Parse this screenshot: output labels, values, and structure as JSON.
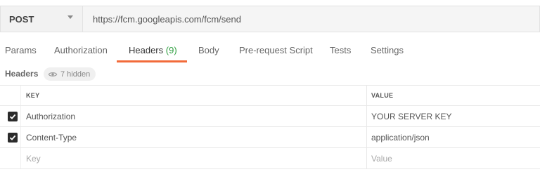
{
  "request": {
    "method": "POST",
    "url": "https://fcm.googleapis.com/fcm/send"
  },
  "tabs": [
    {
      "label": "Params"
    },
    {
      "label": "Authorization"
    },
    {
      "label": "Headers",
      "count": "(9)",
      "active": true
    },
    {
      "label": "Body"
    },
    {
      "label": "Pre-request Script"
    },
    {
      "label": "Tests"
    },
    {
      "label": "Settings"
    }
  ],
  "headers_section": {
    "title": "Headers",
    "hidden_label": "7 hidden"
  },
  "table": {
    "columns": [
      "KEY",
      "VALUE"
    ],
    "rows": [
      {
        "key": "Authorization",
        "value": "YOUR SERVER KEY",
        "checked": true
      },
      {
        "key": "Content-Type",
        "value": "application/json",
        "checked": true
      }
    ],
    "placeholder_row": {
      "key": "Key",
      "value": "Value"
    }
  },
  "colors": {
    "accent_underline": "#f26b3a",
    "count_green": "#2e9e3f",
    "checkbox": "#2b2b2b"
  },
  "icons": {
    "method_dropdown": "chevron-down-icon",
    "hidden_toggle": "eye-icon",
    "checkbox": "check-icon"
  }
}
